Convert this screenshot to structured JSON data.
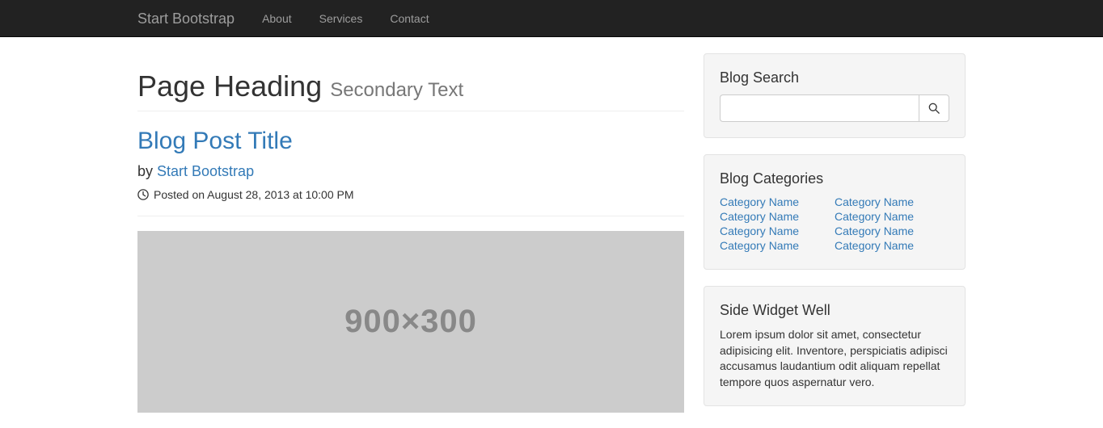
{
  "nav": {
    "brand": "Start Bootstrap",
    "links": [
      "About",
      "Services",
      "Contact"
    ]
  },
  "heading": {
    "main": "Page Heading ",
    "secondary": "Secondary Text"
  },
  "post": {
    "title": "Blog Post Title",
    "by_prefix": "by ",
    "author": "Start Bootstrap",
    "posted_text": "Posted on August 28, 2013 at 10:00 PM",
    "img_label": "900×300"
  },
  "search": {
    "title": "Blog Search",
    "placeholder": ""
  },
  "categories": {
    "title": "Blog Categories",
    "col1": [
      "Category Name",
      "Category Name",
      "Category Name",
      "Category Name"
    ],
    "col2": [
      "Category Name",
      "Category Name",
      "Category Name",
      "Category Name"
    ]
  },
  "sidewidget": {
    "title": "Side Widget Well",
    "text": "Lorem ipsum dolor sit amet, consectetur adipisicing elit. Inventore, perspiciatis adipisci accusamus laudantium odit aliquam repellat tempore quos aspernatur vero."
  }
}
